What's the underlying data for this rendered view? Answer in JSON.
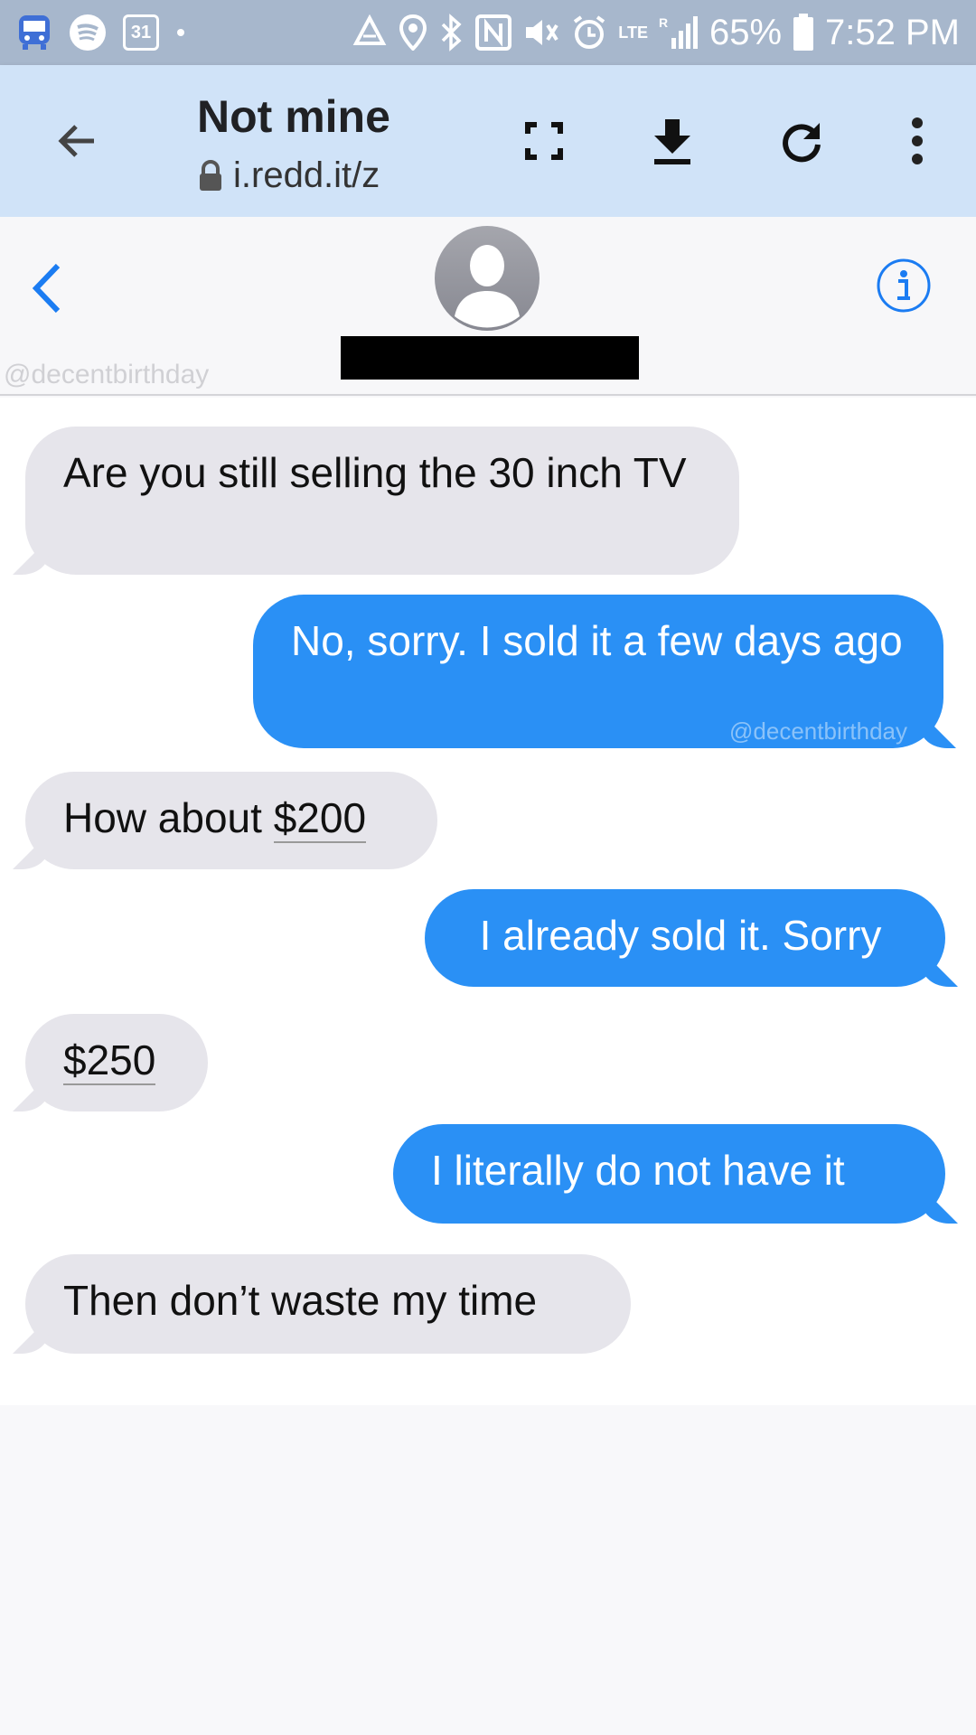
{
  "status_bar": {
    "calendar_day": "31",
    "network": "LTE",
    "roaming": "R",
    "battery_percent": "65%",
    "time": "7:52 PM",
    "icons": [
      "bus-icon",
      "spotify-icon",
      "calendar-icon",
      "dot-icon",
      "recycle-icon",
      "location-icon",
      "bluetooth-icon",
      "nfc-icon",
      "mute-icon",
      "alarm-icon",
      "signal-icon",
      "battery-icon"
    ]
  },
  "browser": {
    "page_title": "Not mine",
    "url": "i.redd.it/z",
    "icons": [
      "back-arrow-icon",
      "lock-icon",
      "fullscreen-icon",
      "download-icon",
      "reload-icon",
      "more-vert-icon"
    ]
  },
  "conversation": {
    "watermark": "@decentbirthday",
    "accent_color": "#2a90f5",
    "incoming_color": "#e6e5eb",
    "messages": [
      {
        "direction": "incoming",
        "text": "Are you still selling the 30 inch TV"
      },
      {
        "direction": "outgoing",
        "text": "No, sorry. I sold it a few days ago",
        "watermark": "@decentbirthday"
      },
      {
        "direction": "incoming",
        "prefix": "How about ",
        "amount": "$200"
      },
      {
        "direction": "outgoing",
        "text": "I already sold it. Sorry"
      },
      {
        "direction": "incoming",
        "amount": "$250"
      },
      {
        "direction": "outgoing",
        "text": "I literally do not have it"
      },
      {
        "direction": "incoming",
        "text": "Then don’t waste my time"
      }
    ]
  }
}
